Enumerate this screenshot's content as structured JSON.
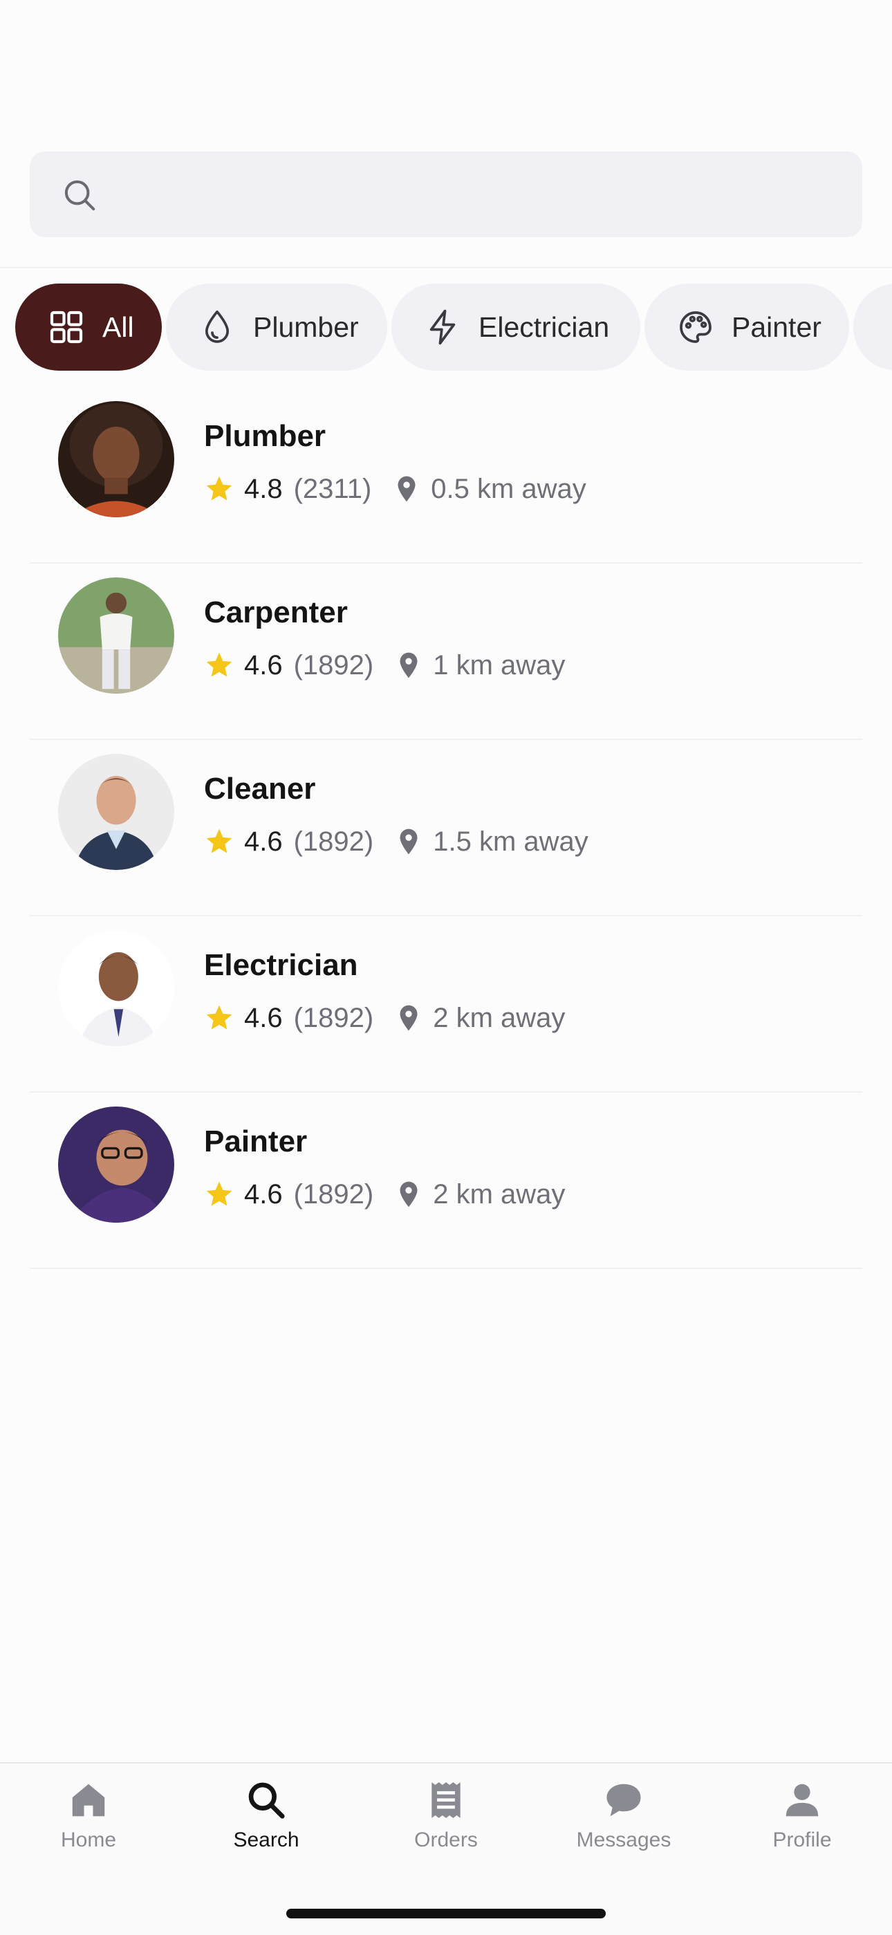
{
  "search": {
    "placeholder": "",
    "icon": "search-icon"
  },
  "filters": [
    {
      "label": "All",
      "icon": "grid-icon",
      "active": true
    },
    {
      "label": "Plumber",
      "icon": "water-drop-icon",
      "active": false
    },
    {
      "label": "Electrician",
      "icon": "lightning-icon",
      "active": false
    },
    {
      "label": "Painter",
      "icon": "palette-icon",
      "active": false
    }
  ],
  "providers": [
    {
      "title": "Plumber",
      "rating": "4.8",
      "reviews": "(2311)",
      "distance": "0.5 km away"
    },
    {
      "title": "Carpenter",
      "rating": "4.6",
      "reviews": "(1892)",
      "distance": "1 km away"
    },
    {
      "title": "Cleaner",
      "rating": "4.6",
      "reviews": "(1892)",
      "distance": "1.5 km away"
    },
    {
      "title": "Electrician",
      "rating": "4.6",
      "reviews": "(1892)",
      "distance": "2 km away"
    },
    {
      "title": "Painter",
      "rating": "4.6",
      "reviews": "(1892)",
      "distance": "2 km away"
    }
  ],
  "tabbar": {
    "tabs": [
      {
        "label": "Home",
        "icon": "home-icon"
      },
      {
        "label": "Search",
        "icon": "search-icon",
        "active": true
      },
      {
        "label": "Orders",
        "icon": "receipt-icon"
      },
      {
        "label": "Messages",
        "icon": "chat-bubble-icon"
      },
      {
        "label": "Profile",
        "icon": "person-icon"
      }
    ]
  },
  "colors": {
    "accent": "#4a1b1b",
    "star": "#f5c518",
    "chip_bg": "#f1f1f5"
  }
}
